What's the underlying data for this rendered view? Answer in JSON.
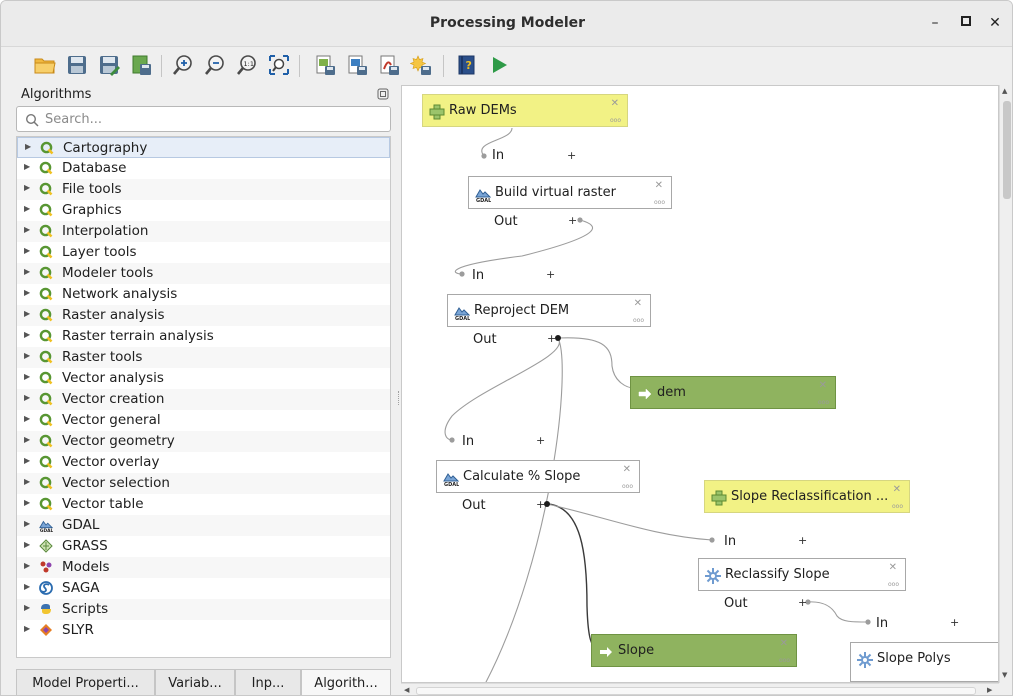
{
  "window": {
    "title": "Processing Modeler",
    "minimize": "–",
    "maximize": "▫",
    "close": "✕"
  },
  "toolbar": {
    "buttons": [
      "open-model",
      "save-model",
      "save-model-as",
      "save-to-project",
      "zoom-in",
      "zoom-out",
      "zoom-actual",
      "zoom-full",
      "export-image",
      "export-pdf",
      "export-svg",
      "export-python",
      "edit-help",
      "run-model"
    ]
  },
  "dock": {
    "title": "Algorithms",
    "search_placeholder": "Search...",
    "providers": [
      {
        "label": "Cartography",
        "icon": "qgis-q-icon"
      },
      {
        "label": "Database",
        "icon": "qgis-q-icon"
      },
      {
        "label": "File tools",
        "icon": "qgis-q-icon"
      },
      {
        "label": "Graphics",
        "icon": "qgis-q-icon"
      },
      {
        "label": "Interpolation",
        "icon": "qgis-q-icon"
      },
      {
        "label": "Layer tools",
        "icon": "qgis-q-icon"
      },
      {
        "label": "Modeler tools",
        "icon": "qgis-q-icon"
      },
      {
        "label": "Network analysis",
        "icon": "qgis-q-icon"
      },
      {
        "label": "Raster analysis",
        "icon": "qgis-q-icon"
      },
      {
        "label": "Raster terrain analysis",
        "icon": "qgis-q-icon"
      },
      {
        "label": "Raster tools",
        "icon": "qgis-q-icon"
      },
      {
        "label": "Vector analysis",
        "icon": "qgis-q-icon"
      },
      {
        "label": "Vector creation",
        "icon": "qgis-q-icon"
      },
      {
        "label": "Vector general",
        "icon": "qgis-q-icon"
      },
      {
        "label": "Vector geometry",
        "icon": "qgis-q-icon"
      },
      {
        "label": "Vector overlay",
        "icon": "qgis-q-icon"
      },
      {
        "label": "Vector selection",
        "icon": "qgis-q-icon"
      },
      {
        "label": "Vector table",
        "icon": "qgis-q-icon"
      },
      {
        "label": "GDAL",
        "icon": "gdal-icon"
      },
      {
        "label": "GRASS",
        "icon": "grass-icon"
      },
      {
        "label": "Models",
        "icon": "models-icon"
      },
      {
        "label": "SAGA",
        "icon": "saga-icon"
      },
      {
        "label": "Scripts",
        "icon": "python-icon"
      },
      {
        "label": "SLYR",
        "icon": "slyr-icon"
      }
    ],
    "tabs": [
      "Model Properti...",
      "Variab...",
      "Inp...",
      "Algorith..."
    ]
  },
  "canvas": {
    "nodes": {
      "raw_dems": "Raw DEMs",
      "build_vrt": "Build virtual raster",
      "reproject": "Reproject DEM",
      "dem_out": "dem",
      "slope": "Calculate % Slope",
      "reclass_input": "Slope Reclassification ...",
      "reclassify": "Reclassify Slope",
      "slope_out": "Slope",
      "slope_polys": "Slope Polys"
    },
    "ports": {
      "in": "In",
      "out": "Out",
      "plus": "+"
    },
    "colors": {
      "input_fill": "#f2f285",
      "output_fill": "#8fb35f",
      "qgis_green": "#589632",
      "run_green": "#2e9a47"
    }
  }
}
